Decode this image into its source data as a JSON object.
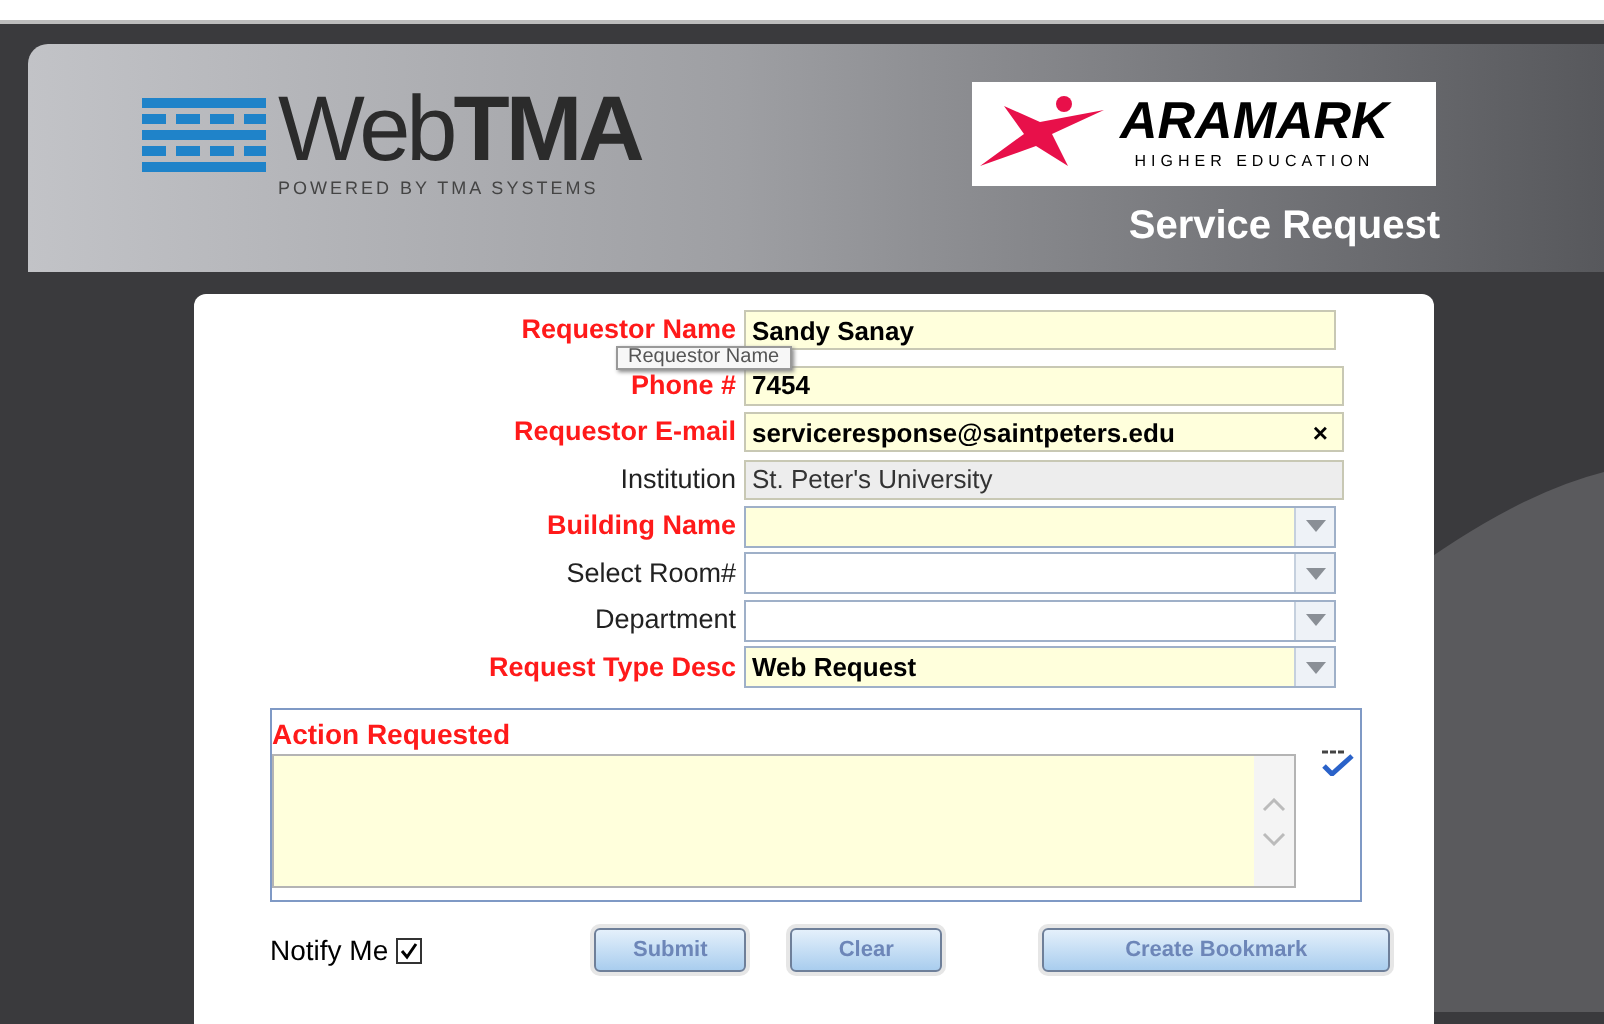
{
  "header": {
    "logo": {
      "web": "Web",
      "tma": "TMA",
      "tagline": "POWERED BY TMA SYSTEMS"
    },
    "partner_logo": {
      "name": "ARAMARK",
      "sub": "HIGHER EDUCATION"
    },
    "title": "Service Request"
  },
  "fields": [
    {
      "label": "Requestor Name",
      "required": true,
      "kind": "text",
      "value": "Sandy Sanay",
      "bold": true
    },
    {
      "label": "Phone #",
      "required": true,
      "kind": "text",
      "value": "7454",
      "bold": true
    },
    {
      "label": "Requestor E-mail",
      "required": true,
      "kind": "text",
      "value": "serviceresponse@saintpeters.edu",
      "bold": true,
      "clear": "×"
    },
    {
      "label": "Institution",
      "required": false,
      "kind": "readonly",
      "value": "St. Peter's University",
      "bold": false
    },
    {
      "label": "Building Name",
      "required": true,
      "kind": "select"
    },
    {
      "label": "Select Room#",
      "required": false,
      "kind": "select"
    },
    {
      "label": "Department",
      "required": false,
      "kind": "select"
    },
    {
      "label": "Request Type Desc",
      "required": true,
      "kind": "select",
      "value": "Web Request",
      "bold": true
    }
  ],
  "tooltip": "Requestor Name",
  "action": {
    "label": "Action Requested"
  },
  "notify": {
    "label": "Notify Me",
    "checked": true
  },
  "buttons": [
    "Submit",
    "Clear",
    "Create Bookmark"
  ]
}
